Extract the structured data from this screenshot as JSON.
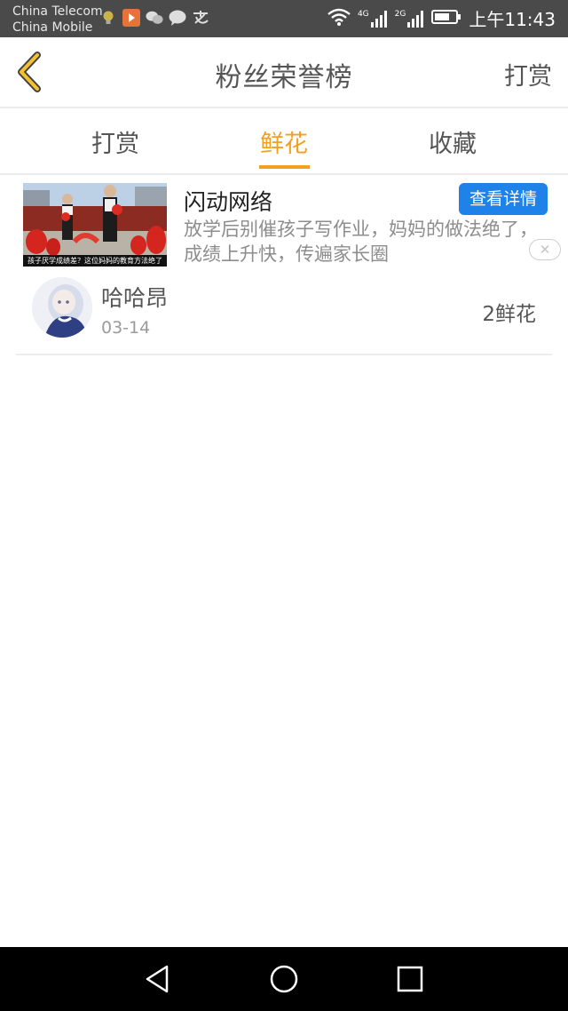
{
  "status_bar": {
    "carrier_1": "China Telecom",
    "carrier_2": "China Mobile",
    "signal_1": "4G",
    "signal_2": "2G",
    "time": "上午11:43",
    "notification_icons": [
      "bulb-icon",
      "play-icon",
      "wechat-icon",
      "message-icon",
      "alipay-icon"
    ]
  },
  "header": {
    "title": "粉丝荣誉榜",
    "right_action": "打赏"
  },
  "tabs": [
    {
      "label": "打赏",
      "active": false
    },
    {
      "label": "鲜花",
      "active": true
    },
    {
      "label": "收藏",
      "active": false
    }
  ],
  "ad": {
    "title": "闪动网络",
    "description": "放学后别催孩子写作业，妈妈的做法绝了，成绩上升快，传遍家长圈",
    "button_label": "查看详情",
    "thumb_caption": "孩子厌学成绩差？这位妈妈的教育方法绝了"
  },
  "list": [
    {
      "name": "哈哈昂",
      "date": "03-14",
      "count": "2鲜花"
    }
  ],
  "colors": {
    "accent": "#f2a01f",
    "button_blue": "#1e82e8",
    "status_bar": "#4a4a4a"
  }
}
